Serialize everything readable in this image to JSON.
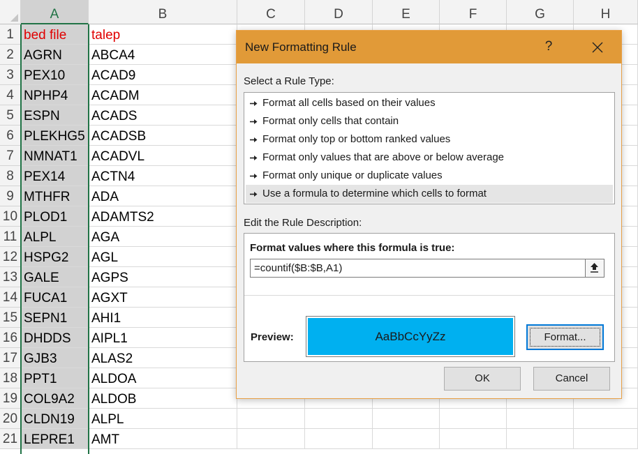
{
  "sheet": {
    "columns": [
      "A",
      "B",
      "C",
      "D",
      "E",
      "F",
      "G",
      "H"
    ],
    "rows": [
      {
        "num": "1",
        "a": "bed file",
        "b": "talep"
      },
      {
        "num": "2",
        "a": "AGRN",
        "b": "ABCA4"
      },
      {
        "num": "3",
        "a": "PEX10",
        "b": "ACAD9"
      },
      {
        "num": "4",
        "a": "NPHP4",
        "b": "ACADM"
      },
      {
        "num": "5",
        "a": "ESPN",
        "b": "ACADS"
      },
      {
        "num": "6",
        "a": "PLEKHG5",
        "b": "ACADSB"
      },
      {
        "num": "7",
        "a": "NMNAT1",
        "b": "ACADVL"
      },
      {
        "num": "8",
        "a": "PEX14",
        "b": "ACTN4"
      },
      {
        "num": "9",
        "a": "MTHFR",
        "b": "ADA"
      },
      {
        "num": "10",
        "a": "PLOD1",
        "b": "ADAMTS2"
      },
      {
        "num": "11",
        "a": "ALPL",
        "b": "AGA"
      },
      {
        "num": "12",
        "a": "HSPG2",
        "b": "AGL"
      },
      {
        "num": "13",
        "a": "GALE",
        "b": "AGPS"
      },
      {
        "num": "14",
        "a": "FUCA1",
        "b": "AGXT"
      },
      {
        "num": "15",
        "a": "SEPN1",
        "b": "AHI1"
      },
      {
        "num": "16",
        "a": "DHDDS",
        "b": "AIPL1"
      },
      {
        "num": "17",
        "a": "GJB3",
        "b": "ALAS2"
      },
      {
        "num": "18",
        "a": "PPT1",
        "b": "ALDOA"
      },
      {
        "num": "19",
        "a": "COL9A2",
        "b": "ALDOB"
      },
      {
        "num": "20",
        "a": "CLDN19",
        "b": "ALPL"
      },
      {
        "num": "21",
        "a": "LEPRE1",
        "b": "AMT"
      }
    ],
    "header_text_color": "#e00000",
    "selection_color": "#217346"
  },
  "dialog": {
    "title": "New Formatting Rule",
    "help_label": "?",
    "select_rule_type_label": "Select a Rule Type:",
    "rule_types": [
      "Format all cells based on their values",
      "Format only cells that contain",
      "Format only top or bottom ranked values",
      "Format only values that are above or below average",
      "Format only unique or duplicate values",
      "Use a formula to determine which cells to format"
    ],
    "selected_rule_index": 5,
    "edit_description_label": "Edit the Rule Description:",
    "formula_label": "Format values where this formula is true:",
    "formula_value": "=countif($B:$B,A1)",
    "preview_label": "Preview:",
    "preview_text": "AaBbCcYyZz",
    "preview_fill": "#00b0f0",
    "format_button": "Format...",
    "ok_button": "OK",
    "cancel_button": "Cancel",
    "title_bar_color": "#e19a38"
  }
}
